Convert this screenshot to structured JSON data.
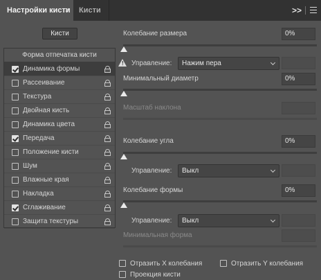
{
  "tabs": {
    "active": "Настройки кисти",
    "active_close": "×",
    "inactive": "Кисти",
    "overflow": ">>"
  },
  "left": {
    "brushes_button": "Кисти",
    "list_header": "Форма отпечатка кисти",
    "items": [
      {
        "label": "Динамика формы",
        "checked": true,
        "selected": true
      },
      {
        "label": "Рассеивание",
        "checked": false,
        "selected": false
      },
      {
        "label": "Текстура",
        "checked": false,
        "selected": false
      },
      {
        "label": "Двойная кисть",
        "checked": false,
        "selected": false
      },
      {
        "label": "Динамика цвета",
        "checked": false,
        "selected": false
      },
      {
        "label": "Передача",
        "checked": true,
        "selected": false
      },
      {
        "label": "Положение кисти",
        "checked": false,
        "selected": false
      },
      {
        "label": "Шум",
        "checked": false,
        "selected": false
      },
      {
        "label": "Влажные края",
        "checked": false,
        "selected": false
      },
      {
        "label": "Накладка",
        "checked": false,
        "selected": false
      },
      {
        "label": "Сглаживание",
        "checked": true,
        "selected": false
      },
      {
        "label": "Защита текстуры",
        "checked": false,
        "selected": false
      }
    ]
  },
  "right": {
    "size_jitter": {
      "label": "Колебание размера",
      "value": "0%",
      "level": 0
    },
    "size_control": {
      "label": "Управление:",
      "value": "Нажим пера"
    },
    "min_diameter": {
      "label": "Минимальный диаметр",
      "value": "0%",
      "level": 0
    },
    "tilt_scale": {
      "label": "Масштаб наклона",
      "value": ""
    },
    "angle_jitter": {
      "label": "Колебание угла",
      "value": "0%",
      "level": 0
    },
    "angle_control": {
      "label": "Управление:",
      "value": "Выкл"
    },
    "roundness_jitter": {
      "label": "Колебание формы",
      "value": "0%",
      "level": 0
    },
    "roundness_control": {
      "label": "Управление:",
      "value": "Выкл"
    },
    "min_roundness": {
      "label": "Минимальная форма",
      "value": ""
    },
    "flip_x": {
      "label": "Отразить X колебания",
      "checked": false
    },
    "flip_y": {
      "label": "Отразить Y колебания",
      "checked": false
    },
    "brush_projection": {
      "label": "Проекция кисти",
      "checked": false
    }
  }
}
